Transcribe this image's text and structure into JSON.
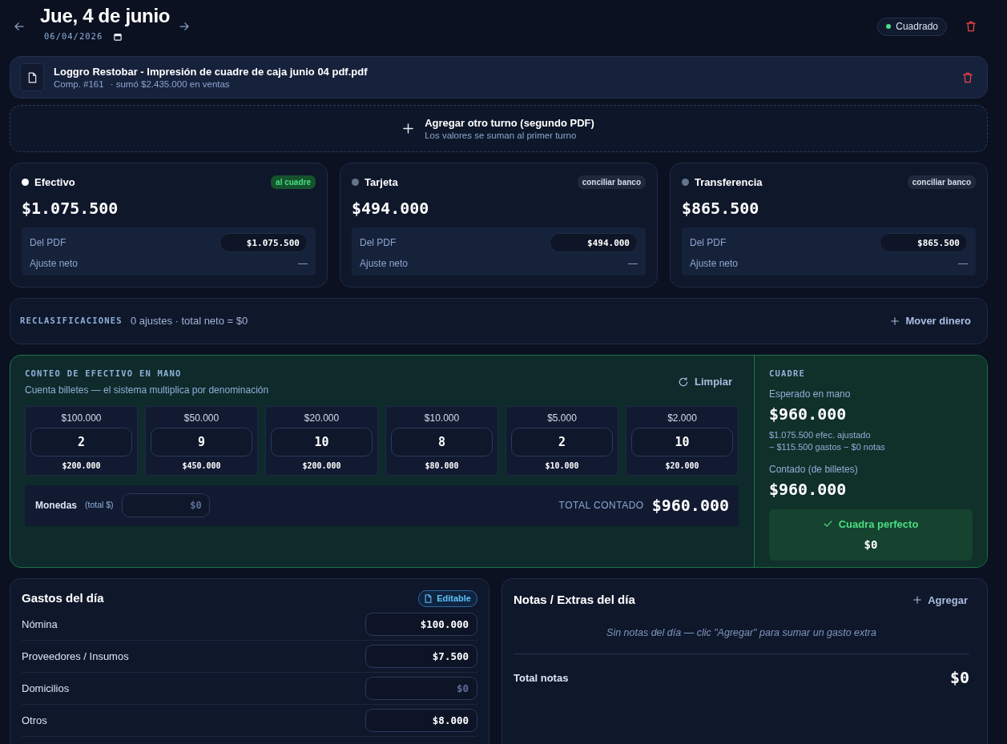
{
  "header": {
    "title": "Jue, 4 de junio",
    "date": "06/04/2026",
    "status": {
      "label": "Cuadrado",
      "kind": "ok"
    }
  },
  "pdf": {
    "filename": "Loggro Restobar - Impresión de cuadre de caja junio 04 pdf.pdf",
    "receipt": "Comp. #161",
    "summary": "· sumó $2.435.000 en ventas"
  },
  "add_shift": {
    "title": "Agregar otro turno (segundo PDF)",
    "subtitle": "Los valores se suman al primer turno"
  },
  "methods": [
    {
      "name": "Efectivo",
      "color": "#ffffff",
      "badge": {
        "text": "al cuadre",
        "kind": "success"
      },
      "amount": "$1.075.500",
      "pdf_label": "Del PDF",
      "pdf_value": "$1.075.500",
      "adjust_label": "Ajuste neto",
      "adjust_value": "—"
    },
    {
      "name": "Tarjeta",
      "color": "#64748b",
      "badge": {
        "text": "conciliar banco",
        "kind": "neutral"
      },
      "amount": "$494.000",
      "pdf_label": "Del PDF",
      "pdf_value": "$494.000",
      "adjust_label": "Ajuste neto",
      "adjust_value": "—"
    },
    {
      "name": "Transferencia",
      "color": "#64748b",
      "badge": {
        "text": "conciliar banco",
        "kind": "neutral"
      },
      "amount": "$865.500",
      "pdf_label": "Del PDF",
      "pdf_value": "$865.500",
      "adjust_label": "Ajuste neto",
      "adjust_value": "—"
    }
  ],
  "reclassifications": {
    "title": "RECLASIFICACIONES",
    "summary": "0 ajustes · total neto = $0",
    "action": "Mover dinero"
  },
  "cash_count": {
    "title": "CONTEO DE EFECTIVO EN MANO",
    "subtitle": "Cuenta billetes — el sistema multiplica por denominación",
    "clear": "Limpiar",
    "denominations": [
      {
        "label": "$100.000",
        "count": "2",
        "subtotal": "$200.000"
      },
      {
        "label": "$50.000",
        "count": "9",
        "subtotal": "$450.000"
      },
      {
        "label": "$20.000",
        "count": "10",
        "subtotal": "$200.000"
      },
      {
        "label": "$10.000",
        "count": "8",
        "subtotal": "$80.000"
      },
      {
        "label": "$5.000",
        "count": "2",
        "subtotal": "$10.000"
      },
      {
        "label": "$2.000",
        "count": "10",
        "subtotal": "$20.000"
      }
    ],
    "coins": {
      "label": "Monedas",
      "hint": "(total $)",
      "placeholder": "$0"
    },
    "total_label": "TOTAL CONTADO",
    "total": "$960.000"
  },
  "balance": {
    "title": "CUADRE",
    "expected_label": "Esperado en mano",
    "expected": "$960.000",
    "formula": [
      "$1.075.500 efec. ajustado",
      "− $115.500 gastos − $0 notas"
    ],
    "counted_label": "Contado (de billetes)",
    "counted": "$960.000",
    "result": {
      "kind": "ok",
      "label": "Cuadra perfecto",
      "difference": "$0"
    }
  },
  "expenses": {
    "title": "Gastos del día",
    "badge": "Editable",
    "rows": [
      {
        "label": "Nómina",
        "value": "$100.000"
      },
      {
        "label": "Proveedores / Insumos",
        "value": "$7.500"
      },
      {
        "label": "Domicilios",
        "placeholder": "$0"
      },
      {
        "label": "Otros",
        "value": "$8.000"
      }
    ]
  },
  "notes": {
    "title": "Notas / Extras del día",
    "action": "Agregar",
    "empty": "Sin notas del día — clic \"Agregar\" para sumar un gasto extra",
    "total_label": "Total notas",
    "total": "$0"
  }
}
